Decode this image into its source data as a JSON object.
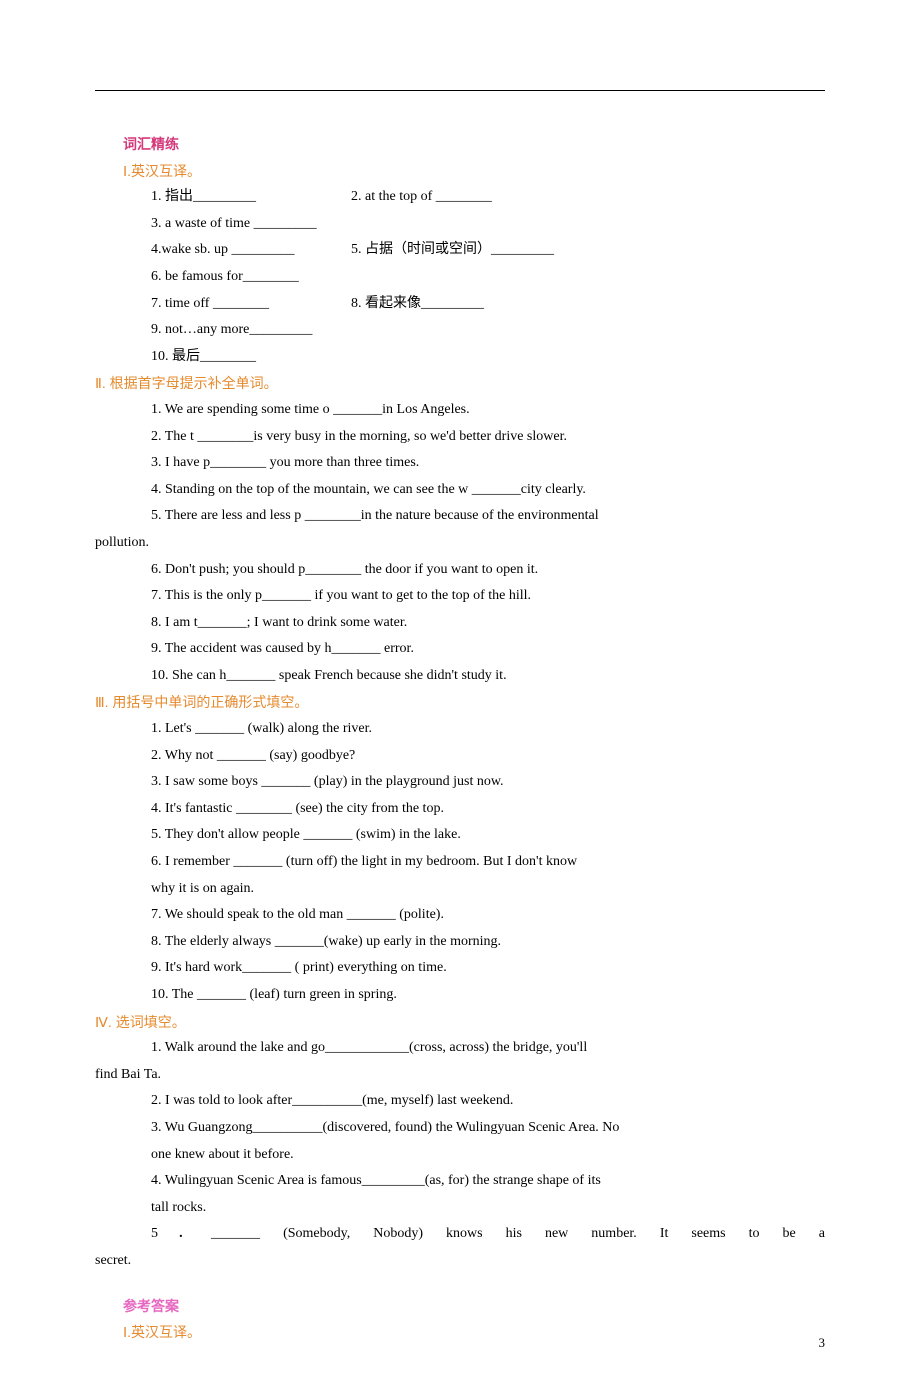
{
  "top": {
    "title": "词汇精练",
    "section1": "Ⅰ.英汉互译。",
    "s1_items": {
      "q1": "1. 指出_________",
      "q2": "2. at the top of ________",
      "q3": "3. a waste of time _________",
      "q4": "4.wake sb. up _________",
      "q5": "5. 占据（时间或空间）_________",
      "q6": "6. be famous for________",
      "q7": "7. time off ________",
      "q8": "8. 看起来像_________",
      "q9": "9. not…any more_________",
      "q10": "10. 最后________"
    },
    "section2": "Ⅱ. 根据首字母提示补全单词。",
    "s2_items": {
      "q1": "1. We are spending some time o _______in Los Angeles.",
      "q2": "2. The t ________is very busy in the morning, so we'd better drive slower.",
      "q3": "3. I have p________ you more than three times.",
      "q4": "4. Standing on the top of the mountain, we can see the w _______city clearly.",
      "q5a": "5. There are less and less p ________in the nature because of the environmental",
      "q5b": "pollution.",
      "q6": "6. Don't push; you should p________ the door if you want to open it.",
      "q7": "7. This is the only p_______ if you want to get to the top of the hill.",
      "q8": "8. I am t_______; I want to drink some water.",
      "q9": "9. The accident was caused by h_______ error.",
      "q10": "10. She can h_______ speak French because she didn't study it."
    },
    "section3": "Ⅲ. 用括号中单词的正确形式填空。",
    "s3_items": {
      "q1": "1. Let's _______ (walk) along the river.",
      "q2": "2. Why not _______ (say) goodbye?",
      "q3": "3. I saw some boys _______ (play) in the playground just now.",
      "q4": "4. It's fantastic ________ (see) the city from the top.",
      "q5": "5. They don't allow people _______ (swim) in the lake.",
      "q6a": "6. I remember _______ (turn off) the light in my bedroom. But I don't know",
      "q6b": "why it is on again.",
      "q7": "7. We should speak to the old man _______ (polite).",
      "q8": "8. The elderly always _______(wake) up early in the morning.",
      "q9": "9. It's hard work_______ ( print) everything on time.",
      "q10": "10. The _______ (leaf) turn green in spring."
    },
    "section4": "Ⅳ. 选词填空。",
    "s4_items": {
      "q1a": "1. Walk around the lake and go____________(cross, across) the bridge, you'll",
      "q1b": "find Bai Ta.",
      "q2": "2. I was told to look after__________(me, myself) last weekend.",
      "q3a": "3. Wu Guangzong__________(discovered, found) the Wulingyuan Scenic Area. No",
      "q3b": "one    knew about it before.",
      "q4a": "4. Wulingyuan Scenic Area is famous_________(as, for) the strange shape of its",
      "q4b": "tall rocks.",
      "q5a": "5．_______ (Somebody, Nobody) knows his new number. It seems to be a",
      "q5b": "secret."
    },
    "answers_title": "参考答案",
    "answers_section1": "Ⅰ.英汉互译。"
  },
  "page_number": "3"
}
